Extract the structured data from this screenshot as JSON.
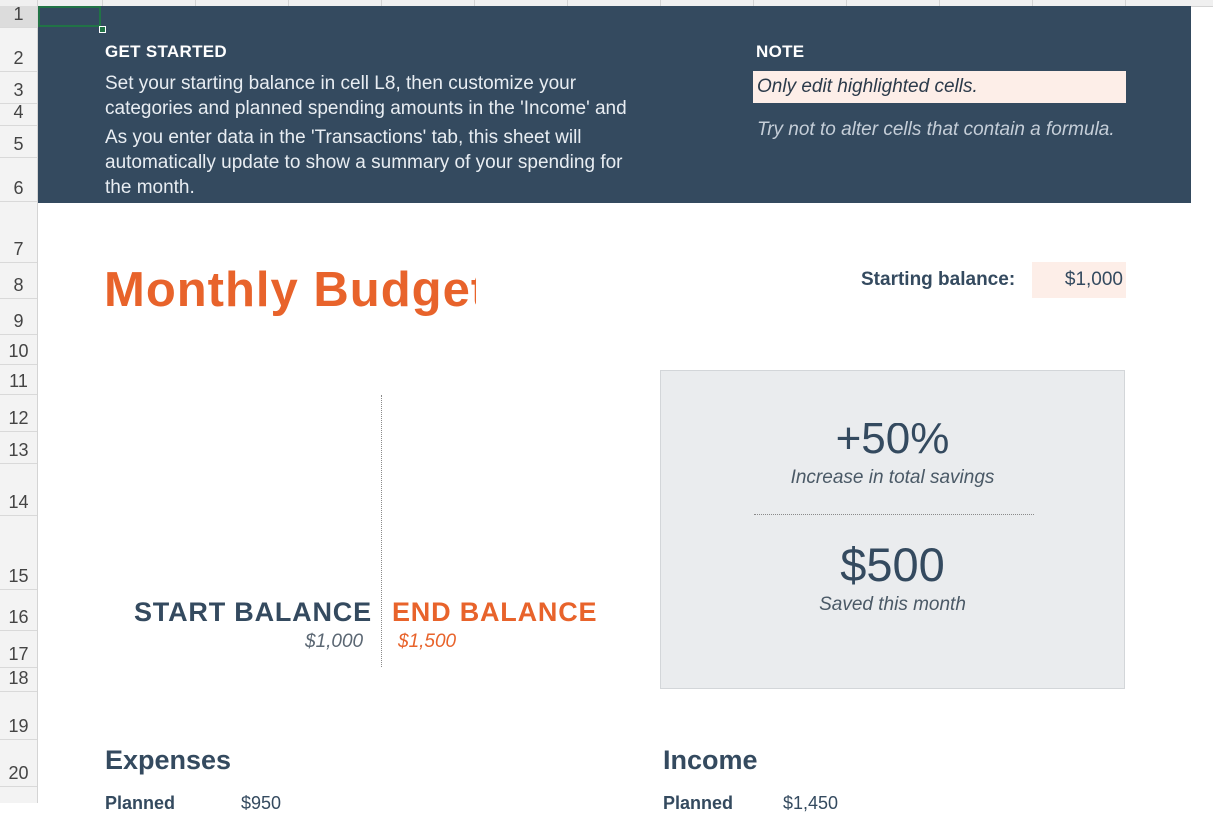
{
  "sheet": {
    "row_numbers": [
      "1",
      "2",
      "3",
      "4",
      "5",
      "6",
      "7",
      "8",
      "9",
      "10",
      "11",
      "12",
      "13",
      "14",
      "15",
      "16",
      "17",
      "18",
      "19",
      "20"
    ]
  },
  "banner": {
    "get_started_heading": "GET STARTED",
    "get_started_line1": "Set your starting balance in cell L8, then customize your",
    "get_started_line2": "categories and planned spending amounts in the 'Income' and",
    "get_started_line3": "As you enter data in the 'Transactions' tab, this sheet will",
    "get_started_line4": "automatically update to show a summary of your spending for",
    "get_started_line5": "the month.",
    "note_heading": "NOTE",
    "note_highlight": "Only edit highlighted cells.",
    "note_sub": "Try not to alter cells that contain a formula.",
    "color_background": "#344a5f",
    "color_highlight": "#fdeee8"
  },
  "budget": {
    "title": "Monthly Budget",
    "starting_balance_label": "Starting balance:",
    "starting_balance_value": "$1,000",
    "accent_color": "#e8632b"
  },
  "balances": {
    "start_label": "START BALANCE",
    "start_value": "$1,000",
    "end_label": "END BALANCE",
    "end_value": "$1,500"
  },
  "summary": {
    "percent": "+50%",
    "percent_caption": "Increase in total savings",
    "saved": "$500",
    "saved_caption": "Saved this month"
  },
  "sections": {
    "expenses_heading": "Expenses",
    "expenses_planned_label": "Planned",
    "expenses_planned_value": "$950",
    "income_heading": "Income",
    "income_planned_label": "Planned",
    "income_planned_value": "$1,450"
  }
}
